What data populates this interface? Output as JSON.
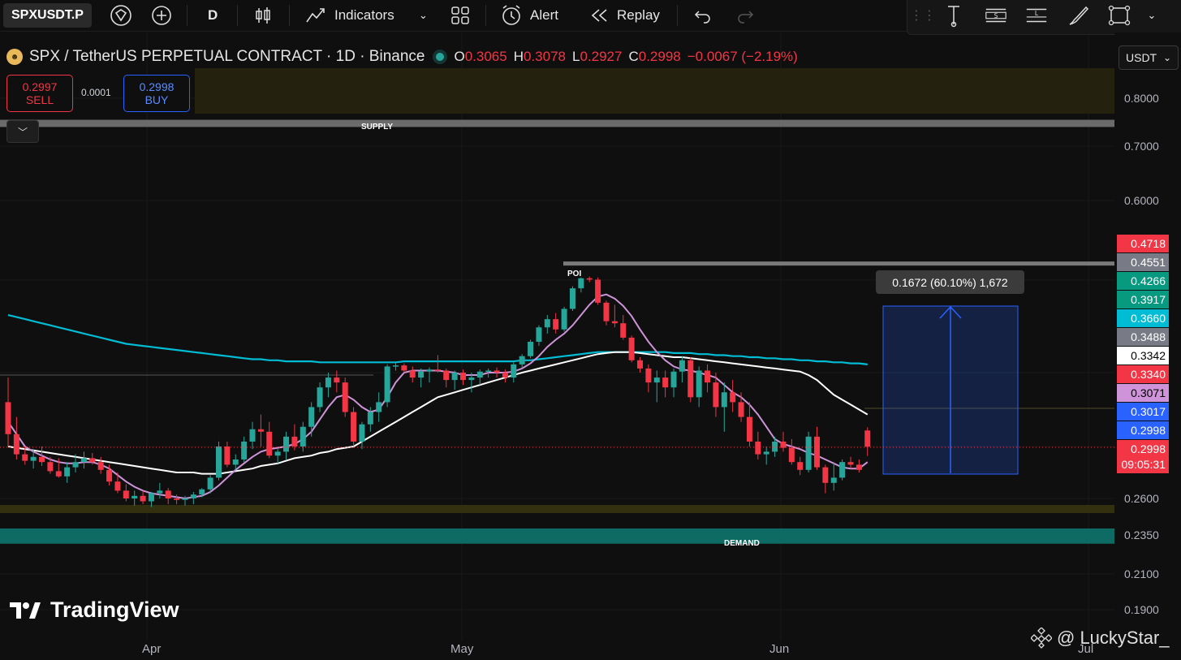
{
  "toolbar": {
    "symbol": "SPXUSDT.P",
    "interval": "D",
    "indicators_label": "Indicators",
    "alert_label": "Alert",
    "replay_label": "Replay"
  },
  "legend": {
    "title": "SPX / TetherUS PERPETUAL CONTRACT · 1D · Binance",
    "o_label": "O",
    "o_value": "0.3065",
    "h_label": "H",
    "h_value": "0.3078",
    "l_label": "L",
    "l_value": "0.2927",
    "c_label": "C",
    "c_value": "0.2998",
    "change": "−0.0067 (−2.19%)"
  },
  "trade": {
    "sell_price": "0.2997",
    "sell_label": "SELL",
    "spread": "0.0001",
    "buy_price": "0.2998",
    "buy_label": "BUY"
  },
  "axis": {
    "currency": "USDT",
    "labels": [
      "0.8000",
      "0.7000",
      "0.6000",
      "0.2600",
      "0.2350",
      "0.2100",
      "0.1900"
    ],
    "time_labels": [
      "Apr",
      "May",
      "Jun",
      "Jul"
    ]
  },
  "price_tags": [
    {
      "value": "0.4718",
      "bg": "#f23645",
      "fg": "#ffffff"
    },
    {
      "value": "0.4551",
      "bg": "#787b86",
      "fg": "#ffffff"
    },
    {
      "value": "0.4266",
      "bg": "#089981",
      "fg": "#ffffff"
    },
    {
      "value": "0.3917",
      "bg": "#089981",
      "fg": "#ffffff"
    },
    {
      "value": "0.3660",
      "bg": "#00bcd4",
      "fg": "#ffffff"
    },
    {
      "value": "0.3488",
      "bg": "#787b86",
      "fg": "#ffffff"
    },
    {
      "value": "0.3342",
      "bg": "#ffffff",
      "fg": "#000000"
    },
    {
      "value": "0.3340",
      "bg": "#f23645",
      "fg": "#ffffff"
    },
    {
      "value": "0.3071",
      "bg": "#ce93d8",
      "fg": "#000000"
    },
    {
      "value": "0.3017",
      "bg": "#2962ff",
      "fg": "#ffffff"
    },
    {
      "value": "0.2998",
      "bg": "#2962ff",
      "fg": "#ffffff"
    },
    {
      "value": "0.2998",
      "bg": "#f23645",
      "fg": "#ffffff"
    }
  ],
  "countdown": "09:05:31",
  "zones": {
    "supply": "SUPPLY",
    "demand": "DEMAND",
    "poi": "POI"
  },
  "measure": {
    "label": "0.1672 (60.10%) 1,672"
  },
  "branding": {
    "tradingview": "TradingView",
    "author": "@ LuckyStar_"
  },
  "colors": {
    "up": "#26a69a",
    "down": "#f23645",
    "ma_fast": "#ce93d8",
    "ma_mid": "#ffffff",
    "ma_slow": "#00bcd4",
    "demand": "#0d6b63",
    "supply": "#6b6b6b",
    "measure": "#2962ff"
  },
  "chart_data": {
    "type": "candlestick",
    "symbol": "SPXUSDT.P",
    "interval": "1D",
    "ohlc_last": {
      "open": 0.3065,
      "high": 0.3078,
      "low": 0.2927,
      "close": 0.2998
    },
    "candles": [
      [
        0.318,
        0.328,
        0.3,
        0.305
      ],
      [
        0.305,
        0.312,
        0.29,
        0.294
      ],
      [
        0.294,
        0.3,
        0.286,
        0.289
      ],
      [
        0.289,
        0.298,
        0.283,
        0.292
      ],
      [
        0.292,
        0.3,
        0.285,
        0.288
      ],
      [
        0.288,
        0.292,
        0.279,
        0.281
      ],
      [
        0.281,
        0.291,
        0.276,
        0.277
      ],
      [
        0.277,
        0.288,
        0.272,
        0.284
      ],
      [
        0.284,
        0.294,
        0.28,
        0.288
      ],
      [
        0.288,
        0.296,
        0.283,
        0.291
      ],
      [
        0.291,
        0.295,
        0.286,
        0.288
      ],
      [
        0.288,
        0.292,
        0.279,
        0.282
      ],
      [
        0.282,
        0.286,
        0.27,
        0.273
      ],
      [
        0.273,
        0.28,
        0.264,
        0.266
      ],
      [
        0.266,
        0.271,
        0.258,
        0.26
      ],
      [
        0.26,
        0.266,
        0.255,
        0.262
      ],
      [
        0.262,
        0.266,
        0.256,
        0.258
      ],
      [
        0.258,
        0.265,
        0.254,
        0.264
      ],
      [
        0.264,
        0.272,
        0.26,
        0.266
      ],
      [
        0.266,
        0.268,
        0.256,
        0.26
      ],
      [
        0.26,
        0.263,
        0.256,
        0.259
      ],
      [
        0.259,
        0.262,
        0.255,
        0.26
      ],
      [
        0.26,
        0.265,
        0.256,
        0.263
      ],
      [
        0.263,
        0.268,
        0.261,
        0.267
      ],
      [
        0.267,
        0.278,
        0.264,
        0.276
      ],
      [
        0.276,
        0.302,
        0.274,
        0.3
      ],
      [
        0.3,
        0.302,
        0.284,
        0.286
      ],
      [
        0.286,
        0.294,
        0.282,
        0.29
      ],
      [
        0.29,
        0.304,
        0.288,
        0.302
      ],
      [
        0.302,
        0.31,
        0.298,
        0.307
      ],
      [
        0.307,
        0.313,
        0.3,
        0.306
      ],
      [
        0.306,
        0.31,
        0.291,
        0.293
      ],
      [
        0.293,
        0.298,
        0.287,
        0.296
      ],
      [
        0.296,
        0.306,
        0.29,
        0.304
      ],
      [
        0.304,
        0.309,
        0.297,
        0.3
      ],
      [
        0.3,
        0.31,
        0.296,
        0.308
      ],
      [
        0.308,
        0.318,
        0.304,
        0.316
      ],
      [
        0.316,
        0.326,
        0.314,
        0.324
      ],
      [
        0.324,
        0.33,
        0.32,
        0.328
      ],
      [
        0.328,
        0.332,
        0.322,
        0.326
      ],
      [
        0.326,
        0.328,
        0.312,
        0.314
      ],
      [
        0.314,
        0.316,
        0.3,
        0.302
      ],
      [
        0.302,
        0.31,
        0.298,
        0.309
      ],
      [
        0.309,
        0.316,
        0.306,
        0.314
      ],
      [
        0.314,
        0.322,
        0.31,
        0.318
      ],
      [
        0.318,
        0.338,
        0.316,
        0.336
      ],
      [
        0.336,
        0.34,
        0.332,
        0.337
      ],
      [
        0.337,
        0.339,
        0.33,
        0.332
      ],
      [
        0.332,
        0.336,
        0.326,
        0.328
      ],
      [
        0.328,
        0.334,
        0.324,
        0.331
      ],
      [
        0.331,
        0.335,
        0.326,
        0.333
      ],
      [
        0.333,
        0.347,
        0.33,
        0.332
      ],
      [
        0.332,
        0.334,
        0.324,
        0.327
      ],
      [
        0.327,
        0.332,
        0.323,
        0.33
      ],
      [
        0.33,
        0.333,
        0.325,
        0.327
      ],
      [
        0.327,
        0.33,
        0.322,
        0.328
      ],
      [
        0.328,
        0.333,
        0.325,
        0.331
      ],
      [
        0.331,
        0.334,
        0.328,
        0.332
      ],
      [
        0.332,
        0.335,
        0.328,
        0.33
      ],
      [
        0.33,
        0.333,
        0.326,
        0.328
      ],
      [
        0.328,
        0.34,
        0.326,
        0.338
      ],
      [
        0.338,
        0.348,
        0.334,
        0.346
      ],
      [
        0.346,
        0.362,
        0.344,
        0.36
      ],
      [
        0.36,
        0.376,
        0.356,
        0.374
      ],
      [
        0.374,
        0.386,
        0.368,
        0.382
      ],
      [
        0.382,
        0.388,
        0.368,
        0.372
      ],
      [
        0.372,
        0.394,
        0.37,
        0.392
      ],
      [
        0.392,
        0.414,
        0.39,
        0.412
      ],
      [
        0.412,
        0.426,
        0.408,
        0.424
      ],
      [
        0.424,
        0.428,
        0.418,
        0.421
      ],
      [
        0.421,
        0.426,
        0.396,
        0.398
      ],
      [
        0.398,
        0.4,
        0.376,
        0.38
      ],
      [
        0.38,
        0.396,
        0.374,
        0.378
      ],
      [
        0.378,
        0.386,
        0.362,
        0.364
      ],
      [
        0.364,
        0.366,
        0.34,
        0.342
      ],
      [
        0.342,
        0.345,
        0.33,
        0.334
      ],
      [
        0.334,
        0.338,
        0.322,
        0.326
      ],
      [
        0.326,
        0.332,
        0.318,
        0.328
      ],
      [
        0.328,
        0.332,
        0.32,
        0.324
      ],
      [
        0.324,
        0.334,
        0.32,
        0.331
      ],
      [
        0.331,
        0.346,
        0.326,
        0.342
      ],
      [
        0.342,
        0.345,
        0.318,
        0.32
      ],
      [
        0.32,
        0.336,
        0.316,
        0.332
      ],
      [
        0.332,
        0.338,
        0.322,
        0.326
      ],
      [
        0.326,
        0.33,
        0.312,
        0.316
      ],
      [
        0.316,
        0.326,
        0.306,
        0.322
      ],
      [
        0.322,
        0.327,
        0.314,
        0.318
      ],
      [
        0.318,
        0.322,
        0.31,
        0.312
      ],
      [
        0.312,
        0.318,
        0.3,
        0.302
      ],
      [
        0.302,
        0.306,
        0.29,
        0.294
      ],
      [
        0.294,
        0.3,
        0.286,
        0.296
      ],
      [
        0.296,
        0.304,
        0.292,
        0.302
      ],
      [
        0.302,
        0.306,
        0.296,
        0.299
      ],
      [
        0.299,
        0.303,
        0.286,
        0.288
      ],
      [
        0.288,
        0.292,
        0.278,
        0.282
      ],
      [
        0.282,
        0.306,
        0.28,
        0.304
      ],
      [
        0.304,
        0.308,
        0.282,
        0.284
      ],
      [
        0.284,
        0.286,
        0.264,
        0.272
      ],
      [
        0.272,
        0.288,
        0.266,
        0.276
      ],
      [
        0.276,
        0.29,
        0.274,
        0.288
      ],
      [
        0.288,
        0.292,
        0.283,
        0.286
      ],
      [
        0.286,
        0.29,
        0.28,
        0.282
      ],
      [
        0.3065,
        0.3078,
        0.2927,
        0.2998
      ]
    ],
    "ma_slow": [
      0.386,
      0.384,
      0.382,
      0.38,
      0.378,
      0.376,
      0.374,
      0.372,
      0.37,
      0.368,
      0.366,
      0.364,
      0.362,
      0.36,
      0.358,
      0.357,
      0.356,
      0.355,
      0.354,
      0.353,
      0.352,
      0.351,
      0.35,
      0.349,
      0.348,
      0.347,
      0.346,
      0.345,
      0.344,
      0.343,
      0.343,
      0.342,
      0.342,
      0.341,
      0.341,
      0.341,
      0.341,
      0.34,
      0.34,
      0.34,
      0.34,
      0.34,
      0.34,
      0.34,
      0.34,
      0.34,
      0.34,
      0.341,
      0.341,
      0.341,
      0.341,
      0.341,
      0.341,
      0.341,
      0.341,
      0.341,
      0.341,
      0.341,
      0.341,
      0.341,
      0.341,
      0.342,
      0.342,
      0.343,
      0.344,
      0.345,
      0.346,
      0.347,
      0.348,
      0.349,
      0.35,
      0.35,
      0.35,
      0.35,
      0.35,
      0.35,
      0.35,
      0.35,
      0.35,
      0.349,
      0.349,
      0.349,
      0.348,
      0.348,
      0.347,
      0.347,
      0.346,
      0.346,
      0.345,
      0.345,
      0.344,
      0.344,
      0.343,
      0.343,
      0.342,
      0.342,
      0.341,
      0.341,
      0.34,
      0.34,
      0.339,
      0.339,
      0.338
    ],
    "ma_mid": [
      0.3,
      0.299,
      0.298,
      0.297,
      0.296,
      0.295,
      0.294,
      0.293,
      0.292,
      0.291,
      0.29,
      0.289,
      0.288,
      0.287,
      0.286,
      0.285,
      0.284,
      0.283,
      0.282,
      0.281,
      0.28,
      0.28,
      0.28,
      0.279,
      0.279,
      0.279,
      0.28,
      0.281,
      0.282,
      0.283,
      0.285,
      0.286,
      0.287,
      0.289,
      0.291,
      0.292,
      0.293,
      0.295,
      0.296,
      0.298,
      0.299,
      0.3,
      0.302,
      0.304,
      0.306,
      0.308,
      0.31,
      0.312,
      0.314,
      0.316,
      0.318,
      0.32,
      0.321,
      0.322,
      0.323,
      0.324,
      0.325,
      0.326,
      0.327,
      0.328,
      0.329,
      0.33,
      0.332,
      0.334,
      0.336,
      0.338,
      0.34,
      0.342,
      0.344,
      0.346,
      0.348,
      0.349,
      0.35,
      0.35,
      0.35,
      0.349,
      0.348,
      0.347,
      0.346,
      0.345,
      0.345,
      0.344,
      0.343,
      0.342,
      0.341,
      0.34,
      0.339,
      0.338,
      0.337,
      0.336,
      0.335,
      0.334,
      0.333,
      0.332,
      0.331,
      0.329,
      0.327,
      0.324,
      0.321,
      0.319,
      0.317,
      0.315,
      0.313
    ],
    "ma_fast": [
      0.31,
      0.305,
      0.3,
      0.296,
      0.293,
      0.29,
      0.288,
      0.287,
      0.287,
      0.288,
      0.288,
      0.286,
      0.283,
      0.278,
      0.273,
      0.269,
      0.266,
      0.264,
      0.263,
      0.262,
      0.261,
      0.26,
      0.261,
      0.262,
      0.265,
      0.27,
      0.276,
      0.282,
      0.287,
      0.292,
      0.296,
      0.298,
      0.299,
      0.3,
      0.301,
      0.303,
      0.306,
      0.311,
      0.316,
      0.32,
      0.321,
      0.319,
      0.316,
      0.314,
      0.315,
      0.32,
      0.326,
      0.33,
      0.332,
      0.332,
      0.332,
      0.332,
      0.331,
      0.33,
      0.329,
      0.329,
      0.329,
      0.33,
      0.33,
      0.33,
      0.331,
      0.334,
      0.339,
      0.346,
      0.355,
      0.362,
      0.368,
      0.376,
      0.386,
      0.396,
      0.404,
      0.406,
      0.402,
      0.395,
      0.385,
      0.372,
      0.36,
      0.35,
      0.342,
      0.336,
      0.333,
      0.332,
      0.33,
      0.329,
      0.328,
      0.325,
      0.322,
      0.32,
      0.317,
      0.313,
      0.308,
      0.303,
      0.301,
      0.3,
      0.298,
      0.295,
      0.293,
      0.29,
      0.287,
      0.284,
      0.283,
      0.283,
      0.288
    ],
    "supply_zone": [
      0.74,
      0.755
    ],
    "poi_zone": [
      0.4551,
      0.462
    ],
    "demand_zone": [
      0.229,
      0.239
    ],
    "support_band": [
      0.256,
      0.26
    ],
    "measure_range": [
      0.27,
      0.4372
    ],
    "xlabels": [
      "Apr",
      "May",
      "Jun",
      "Jul"
    ],
    "ylabels": [
      "0.8000",
      "0.7000",
      "0.6000",
      "0.2600",
      "0.2350",
      "0.2100",
      "0.1900"
    ]
  }
}
